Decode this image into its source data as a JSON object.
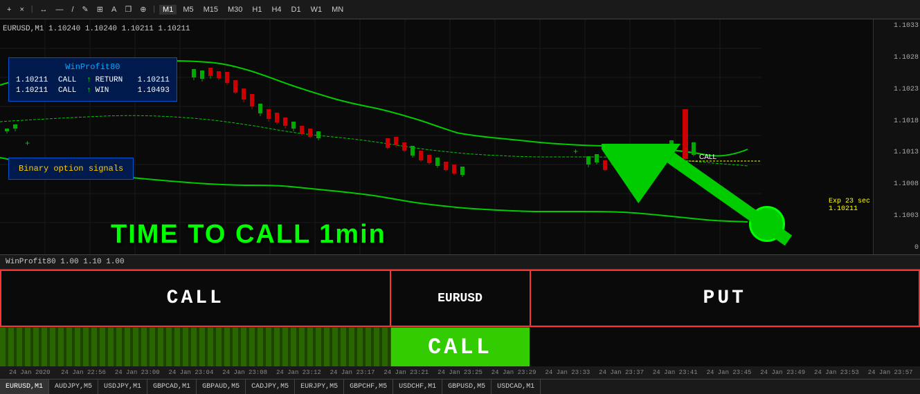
{
  "toolbar": {
    "buttons": [
      "+",
      "×",
      "↔",
      "—",
      "/",
      "✎",
      "⊞",
      "A",
      "❐",
      "⊕"
    ],
    "timeframes": [
      "M1",
      "M5",
      "M15",
      "M30",
      "H1",
      "H4",
      "D1",
      "W1",
      "MN"
    ],
    "active_timeframe": "M1"
  },
  "price_label": "EURUSD,M1  1.10240  1.10240  1.10211  1.10211",
  "winprofit": {
    "title": "WinProfit80",
    "rows": [
      {
        "price": "1.10211",
        "signal": "CALL",
        "arrow": "↑",
        "label": "RETURN",
        "value": "1.10211"
      },
      {
        "price": "1.10211",
        "signal": "CALL",
        "arrow": "↑",
        "label": "WIN",
        "value": "1.10493"
      }
    ]
  },
  "binary_signals": "Binary option signals",
  "time_to_call": "TIME TO CALL 1min",
  "exp_label": "Exp 23 sec",
  "exp_price": "1.10211",
  "call_signal_label": "CALL",
  "bottom_bar": {
    "text": "WinProfit80  1.00  1.10  1.00"
  },
  "signal_section": {
    "call_label": "CALL",
    "symbol": "EURUSD",
    "put_label": "PUT"
  },
  "call_button": "CALL",
  "time_ticks": [
    "24 Jan 2020",
    "24 Jan 22:56",
    "24 Jan 23:00",
    "24 Jan 23:04",
    "24 Jan 23:08",
    "24 Jan 23:12",
    "24 Jan 23:17",
    "24 Jan 23:21",
    "24 Jan 23:25",
    "24 Jan 23:29",
    "24 Jan 23:33",
    "24 Jan 23:37",
    "24 Jan 23:41",
    "24 Jan 23:45",
    "24 Jan 23:49",
    "24 Jan 23:53",
    "24 Jan 23:57"
  ],
  "symbol_tabs": [
    {
      "label": "EURUSD,M1",
      "active": true
    },
    {
      "label": "AUDJPY,M5",
      "active": false
    },
    {
      "label": "USDJPY,M1",
      "active": false
    },
    {
      "label": "GBPCAD,M1",
      "active": false
    },
    {
      "label": "GBPAUD,M5",
      "active": false
    },
    {
      "label": "CADJPY,M5",
      "active": false
    },
    {
      "label": "EURJPY,M5",
      "active": false
    },
    {
      "label": "GBPCHF,M5",
      "active": false
    },
    {
      "label": "USDCHF,M1",
      "active": false
    },
    {
      "label": "GBPUSD,M5",
      "active": false
    },
    {
      "label": "USDCAD,M1",
      "active": false
    }
  ],
  "price_axis": [
    "1.1033",
    "1.1028",
    "1.1023",
    "1.1018",
    "1.1013",
    "1.1008",
    "1.1003",
    "0"
  ]
}
